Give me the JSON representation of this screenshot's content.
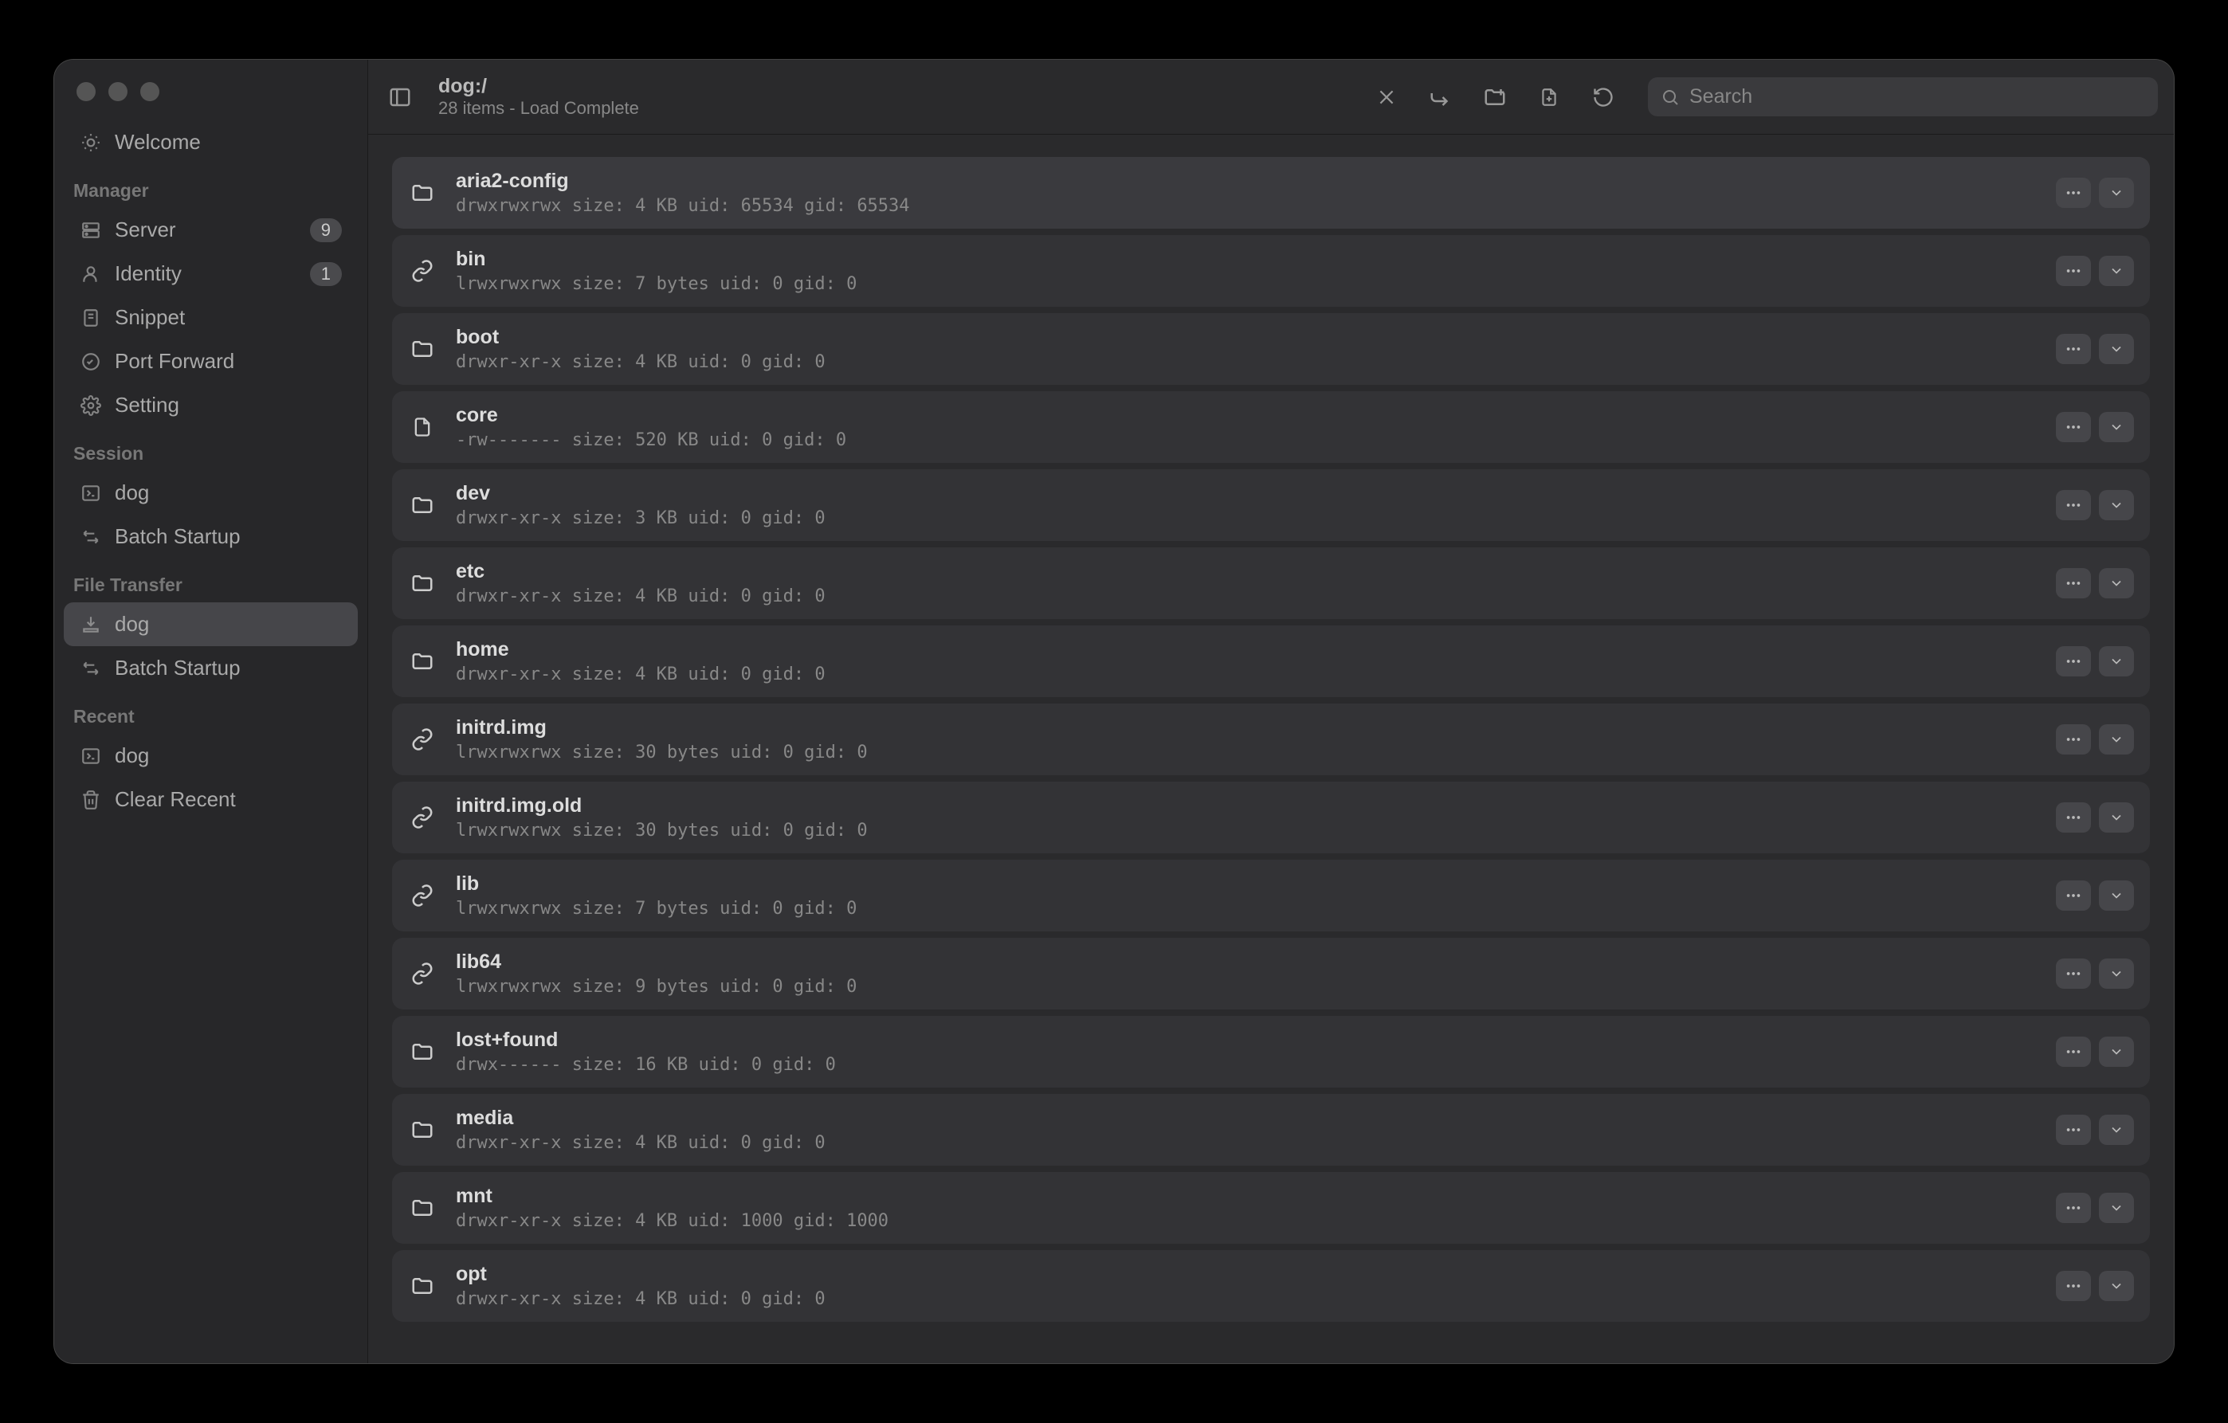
{
  "header": {
    "title": "dog:/",
    "subtitle": "28 items - Load Complete",
    "search_placeholder": "Search"
  },
  "sidebar": {
    "welcome": "Welcome",
    "sections": {
      "manager": {
        "label": "Manager",
        "items": [
          {
            "icon": "server-icon",
            "label": "Server",
            "badge": "9"
          },
          {
            "icon": "identity-icon",
            "label": "Identity",
            "badge": "1"
          },
          {
            "icon": "snippet-icon",
            "label": "Snippet"
          },
          {
            "icon": "port-forward-icon",
            "label": "Port Forward"
          },
          {
            "icon": "setting-icon",
            "label": "Setting"
          }
        ]
      },
      "session": {
        "label": "Session",
        "items": [
          {
            "icon": "terminal-icon",
            "label": "dog"
          },
          {
            "icon": "batch-icon",
            "label": "Batch Startup"
          }
        ]
      },
      "file_transfer": {
        "label": "File Transfer",
        "items": [
          {
            "icon": "transfer-icon",
            "label": "dog",
            "active": true
          },
          {
            "icon": "batch-icon",
            "label": "Batch Startup"
          }
        ]
      },
      "recent": {
        "label": "Recent",
        "items": [
          {
            "icon": "terminal-icon",
            "label": "dog"
          },
          {
            "icon": "trash-icon",
            "label": "Clear Recent"
          }
        ]
      }
    }
  },
  "files": [
    {
      "type": "folder",
      "name": "aria2-config",
      "meta": "drwxrwxrwx size: 4 KB uid: 65534 gid: 65534",
      "hover": true
    },
    {
      "type": "link",
      "name": "bin",
      "meta": "lrwxrwxrwx size: 7 bytes uid: 0 gid: 0"
    },
    {
      "type": "folder",
      "name": "boot",
      "meta": "drwxr-xr-x size: 4 KB uid: 0 gid: 0"
    },
    {
      "type": "file",
      "name": "core",
      "meta": "-rw------- size: 520 KB uid: 0 gid: 0"
    },
    {
      "type": "folder",
      "name": "dev",
      "meta": "drwxr-xr-x size: 3 KB uid: 0 gid: 0"
    },
    {
      "type": "folder",
      "name": "etc",
      "meta": "drwxr-xr-x size: 4 KB uid: 0 gid: 0"
    },
    {
      "type": "folder",
      "name": "home",
      "meta": "drwxr-xr-x size: 4 KB uid: 0 gid: 0"
    },
    {
      "type": "link",
      "name": "initrd.img",
      "meta": "lrwxrwxrwx size: 30 bytes uid: 0 gid: 0"
    },
    {
      "type": "link",
      "name": "initrd.img.old",
      "meta": "lrwxrwxrwx size: 30 bytes uid: 0 gid: 0"
    },
    {
      "type": "link",
      "name": "lib",
      "meta": "lrwxrwxrwx size: 7 bytes uid: 0 gid: 0"
    },
    {
      "type": "link",
      "name": "lib64",
      "meta": "lrwxrwxrwx size: 9 bytes uid: 0 gid: 0"
    },
    {
      "type": "folder",
      "name": "lost+found",
      "meta": "drwx------ size: 16 KB uid: 0 gid: 0"
    },
    {
      "type": "folder",
      "name": "media",
      "meta": "drwxr-xr-x size: 4 KB uid: 0 gid: 0"
    },
    {
      "type": "folder",
      "name": "mnt",
      "meta": "drwxr-xr-x size: 4 KB uid: 1000 gid: 1000"
    },
    {
      "type": "folder",
      "name": "opt",
      "meta": "drwxr-xr-x size: 4 KB uid: 0 gid: 0"
    }
  ]
}
